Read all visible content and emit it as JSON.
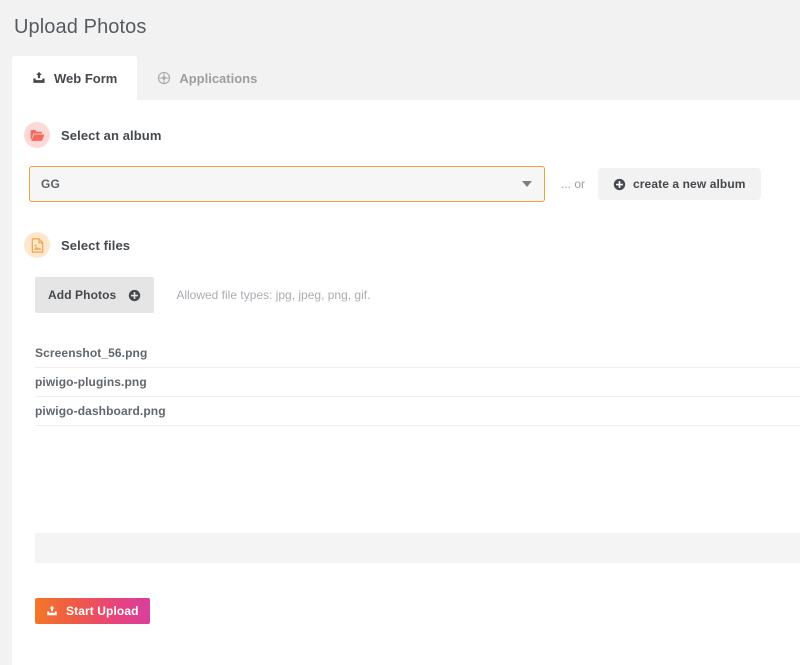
{
  "page": {
    "title": "Upload Photos"
  },
  "tabs": [
    {
      "label": "Web Form",
      "icon": "upload-icon",
      "active": true
    },
    {
      "label": "Applications",
      "icon": "applications-icon",
      "active": false
    }
  ],
  "album_section": {
    "title": "Select an album",
    "icon": "folder-open-icon",
    "select": {
      "value": "GG",
      "caret_icon": "chevron-down-icon"
    },
    "or_label": "... or",
    "create_button": {
      "label": "create a new album",
      "icon": "plus-circle-icon"
    }
  },
  "files_section": {
    "title": "Select files",
    "icon": "file-image-icon",
    "add_button": {
      "label": "Add Photos",
      "icon": "plus-circle-icon"
    },
    "allowed_types": "Allowed file types: jpg, jpeg, png, gif.",
    "files": [
      {
        "name": "Screenshot_56.png"
      },
      {
        "name": "piwigo-plugins.png"
      },
      {
        "name": "piwigo-dashboard.png"
      }
    ]
  },
  "footer": {
    "start_upload": {
      "label": "Start Upload",
      "icon": "upload-icon"
    }
  },
  "colors": {
    "accent_orange": "#f0a03c",
    "album_icon": "#f4685e",
    "files_icon": "#f5a44a",
    "gradient_start": "#f47629",
    "gradient_end": "#d93f9c",
    "page_bg": "#f2f2f2"
  }
}
